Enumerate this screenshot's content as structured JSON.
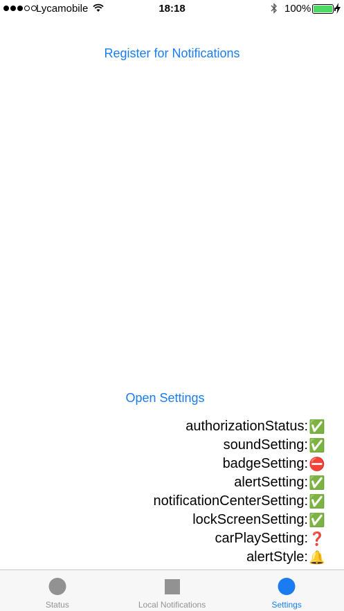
{
  "status_bar": {
    "carrier": "Lycamobile",
    "time": "18:18",
    "battery": "100%",
    "signal_bars_filled": 3,
    "signal_bars_total": 5
  },
  "main": {
    "register_label": "Register for Notifications",
    "open_settings_label": "Open Settings",
    "settings": [
      {
        "label": "authorizationStatus:",
        "status": "✅"
      },
      {
        "label": "soundSetting:",
        "status": "✅"
      },
      {
        "label": "badgeSetting:",
        "status": "⛔"
      },
      {
        "label": "alertSetting:",
        "status": "✅"
      },
      {
        "label": "notificationCenterSetting:",
        "status": "✅"
      },
      {
        "label": "lockScreenSetting:",
        "status": "✅"
      },
      {
        "label": "carPlaySetting:",
        "status": "❓"
      },
      {
        "label": "alertStyle:",
        "status": "🔔"
      }
    ]
  },
  "tab_bar": {
    "tabs": [
      {
        "label": "Status",
        "icon": "circle-icon",
        "active": false
      },
      {
        "label": "Local Notifications",
        "icon": "square-icon",
        "active": false
      },
      {
        "label": "Settings",
        "icon": "circle-icon",
        "active": true
      }
    ]
  },
  "colors": {
    "accent": "#1a7cf0",
    "tab_inactive": "#929292",
    "battery": "#4cd964"
  }
}
